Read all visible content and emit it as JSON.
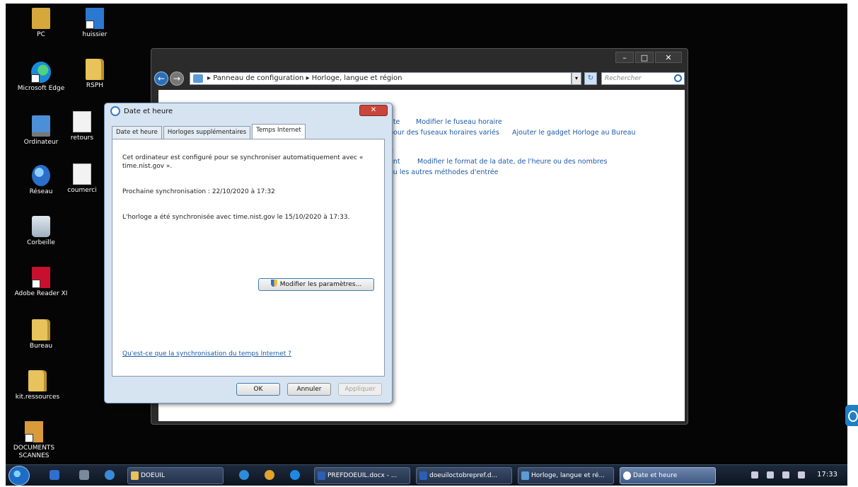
{
  "desktop": {
    "icons_col1": [
      {
        "label": "PC",
        "icon": "pc-icon"
      },
      {
        "label": "Microsoft Edge",
        "icon": "edge-icon"
      },
      {
        "label": "Ordinateur",
        "icon": "computer-icon"
      },
      {
        "label": "Réseau",
        "icon": "network-icon"
      },
      {
        "label": "Corbeille",
        "icon": "recycle-bin-icon"
      },
      {
        "label": "Adobe Reader XI",
        "icon": "adobe-reader-icon"
      },
      {
        "label": "Bureau",
        "icon": "folder-icon"
      },
      {
        "label": "kit.ressources",
        "icon": "folder-icon"
      },
      {
        "label": "DOCUMENTS SCANNES",
        "icon": "documents-scans-icon"
      }
    ],
    "icons_col2": [
      {
        "label": "huissier",
        "icon": "shortcut-icon"
      },
      {
        "label": "RSPH",
        "icon": "folder-icon"
      },
      {
        "label": "retours",
        "icon": "document-icon"
      },
      {
        "label": "coumerci",
        "icon": "document-icon"
      }
    ]
  },
  "control_panel": {
    "breadcrumb_1": "Panneau de configuration",
    "breadcrumb_2": "Horloge, langue et région",
    "search_placeholder": "Rechercher",
    "links": [
      "Modifier le fuseau horaire",
      "Ajouter le gadget Horloge au Bureau",
      "Modifier le format de la date, de l'heure ou des nombres"
    ],
    "fragments": [
      "ate",
      "pour des fuseaux horaires variés",
      "e",
      "ent",
      "ou les autres méthodes d'entrée"
    ]
  },
  "dialog": {
    "title": "Date et heure",
    "tabs": [
      "Date et heure",
      "Horloges supplémentaires",
      "Temps Internet"
    ],
    "active_tab": 2,
    "sync_text": "Cet ordinateur est configuré pour se synchroniser automatiquement avec « time.nist.gov ».",
    "next_sync": "Prochaine synchronisation : 22/10/2020 à 17:32",
    "last_sync": "L'horloge a été synchronisée avec time.nist.gov le 15/10/2020 à 17:33.",
    "modify_button": "Modifier les paramètres...",
    "help_link": "Qu'est-ce que la synchronisation du temps Internet ?",
    "ok": "OK",
    "cancel": "Annuler",
    "apply": "Appliquer"
  },
  "taskbar": {
    "items": [
      {
        "label": "DOEUIL",
        "active": false
      },
      {
        "label": "PREFDOEUIL.docx - ...",
        "active": false
      },
      {
        "label": "doeuiloctobrepref.d...",
        "active": false
      },
      {
        "label": "Horloge, langue et ré...",
        "active": false
      },
      {
        "label": "Date et heure",
        "active": true
      }
    ],
    "clock": "17:33"
  },
  "colors": {
    "desktop": "#050505",
    "link": "#1e5aa8",
    "dialog_frame": "#d6e4f2"
  }
}
